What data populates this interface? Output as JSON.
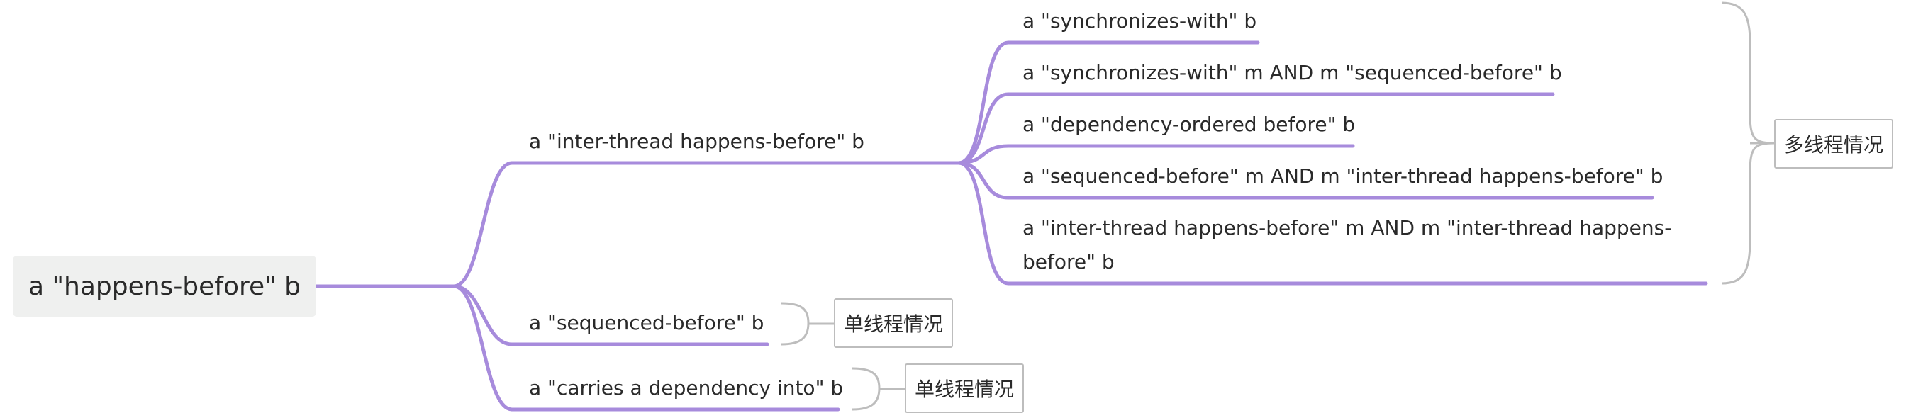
{
  "mindmap": {
    "root": {
      "text": "a \"happens-before\" b"
    },
    "branch_inter": {
      "text": "a \"inter-thread  happens-before\" b"
    },
    "branch_seq": {
      "text": "a \"sequenced-before\" b"
    },
    "branch_carries": {
      "text": "a \"carries a dependency into\" b"
    },
    "inter_children": [
      {
        "text": "a \"synchronizes-with\" b"
      },
      {
        "text": "a \"synchronizes-with\" m AND m \"sequenced-before\" b"
      },
      {
        "text": "a \"dependency-ordered before\" b"
      },
      {
        "text": "a \"sequenced-before\" m AND m \"inter-thread happens-before\" b"
      },
      {
        "text": "a \"inter-thread happens-before\" m AND m \"inter-thread happens-before\" b"
      }
    ],
    "notes": {
      "multi_thread": "多线程情况",
      "single_thread_seq": "单线程情况",
      "single_thread_carries": "单线程情况"
    },
    "colors": {
      "edge": "#a78bdc",
      "root_bg": "#eff0ef",
      "bracket": "#bdbdbd"
    }
  }
}
